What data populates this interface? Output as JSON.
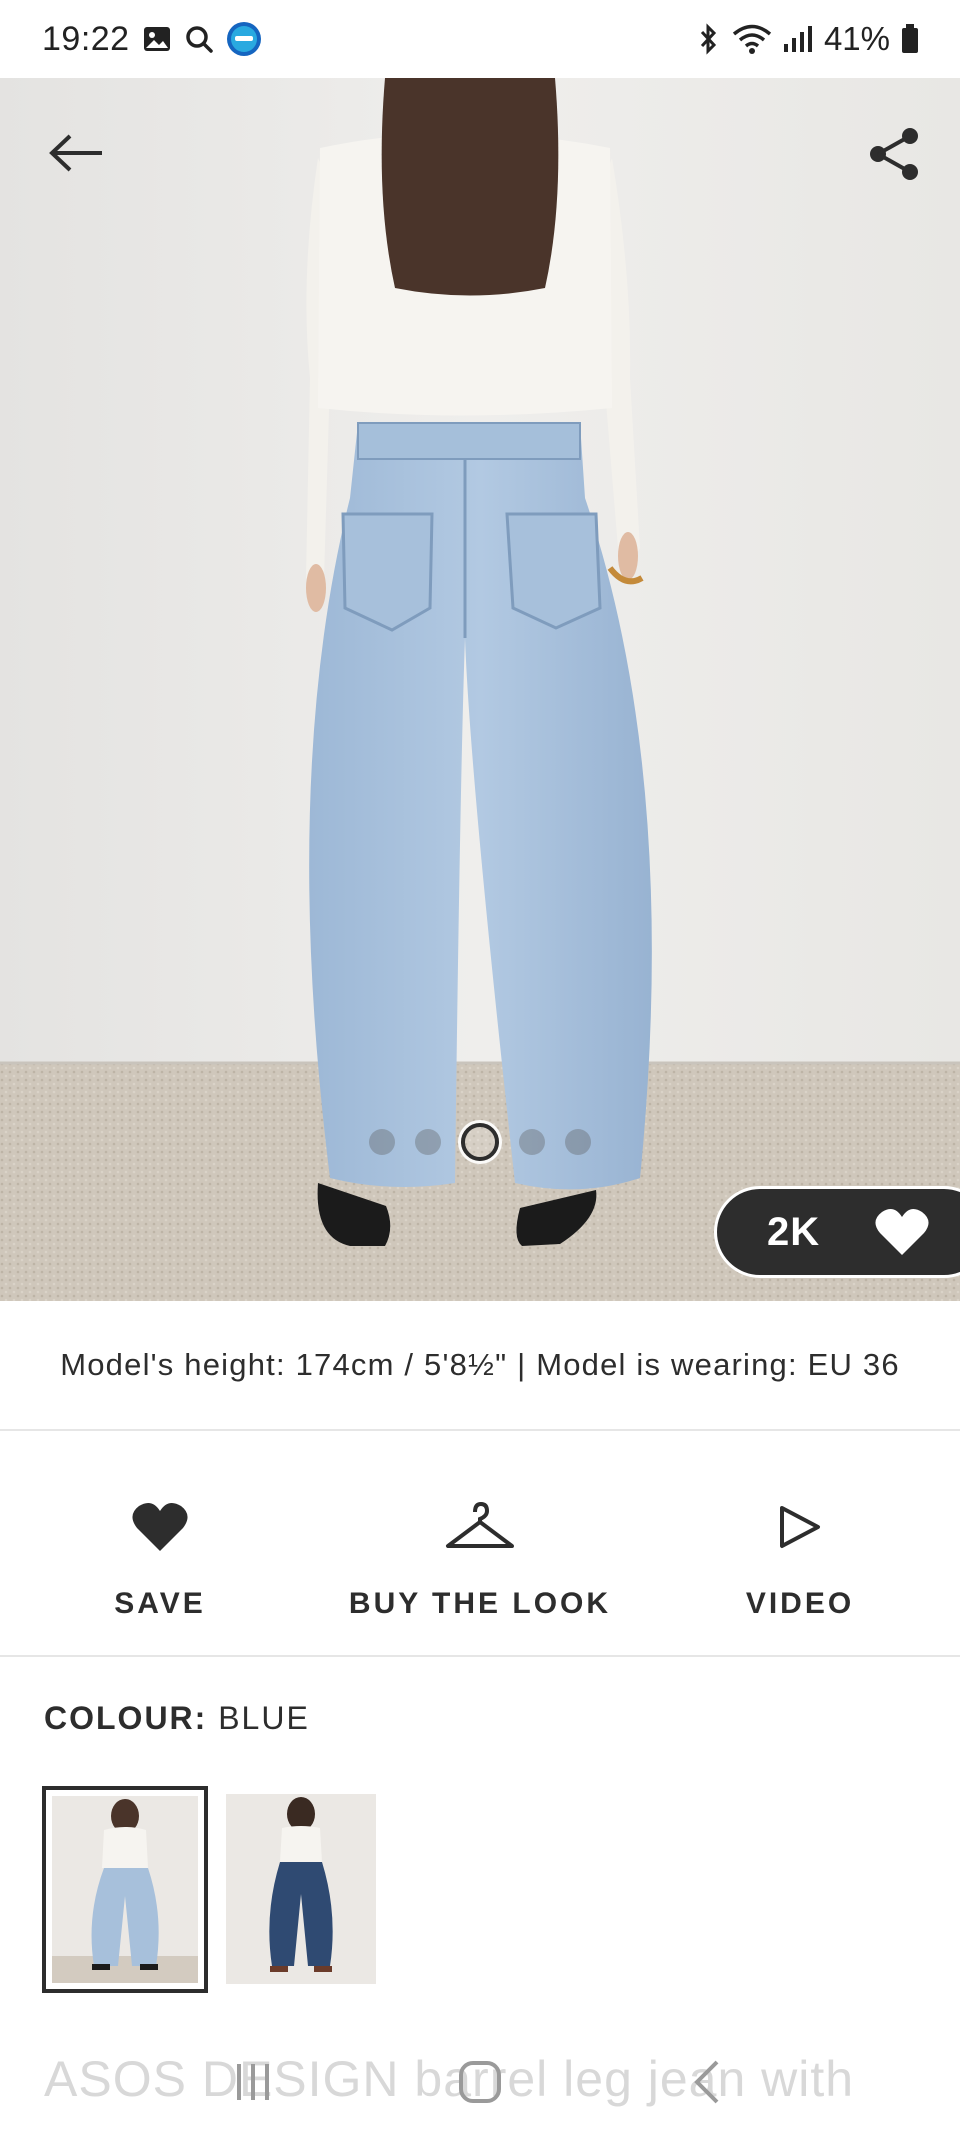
{
  "status_bar": {
    "time": "19:22",
    "battery": "41%",
    "icons": [
      "gallery-icon",
      "search-icon",
      "app-icon",
      "bluetooth-icon",
      "wifi-icon",
      "signal-icon",
      "battery-icon"
    ]
  },
  "hero": {
    "back_icon": "arrow-left-icon",
    "share_icon": "share-icon",
    "carousel": {
      "total": 5,
      "active_index": 2
    },
    "likes": "2K",
    "likes_icon": "heart-icon"
  },
  "model_info": "Model's height: 174cm / 5'8½\" | Model is wearing: EU 36",
  "actions": {
    "save": "SAVE",
    "buy_the_look": "BUY THE LOOK",
    "video": "VIDEO"
  },
  "colour": {
    "label": "COLOUR:",
    "value": "BLUE",
    "swatches": [
      "Light blue",
      "Dark blue"
    ]
  },
  "product_title": "ASOS DESIGN barrel leg jean with",
  "colors": {
    "text": "#2d2d2d",
    "pill": "#2d2d2d",
    "light_denim": "#a9c3de",
    "dark_denim": "#2f4a72"
  }
}
